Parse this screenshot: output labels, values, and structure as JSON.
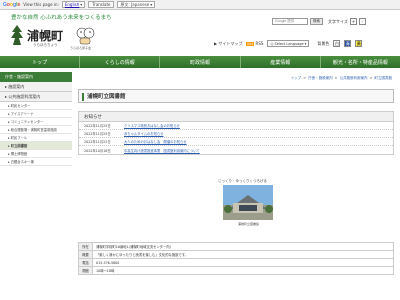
{
  "translate": {
    "brand_letters": [
      "G",
      "o",
      "o",
      "g",
      "l",
      "e"
    ],
    "view_text": "View this page in:",
    "language": "English",
    "translate_button": "Translate",
    "original_option": "原文: Japanese"
  },
  "header": {
    "tagline": "豊かな自然 心ふれあう未来をつくるまち",
    "town_name": "浦幌町",
    "town_kana": "うらほろちょう",
    "mascot_name": "うらほろ男子会",
    "search_placeholder": "Google 提供",
    "search_button": "検索",
    "text_size_label": "文字サイズ",
    "size_up": "+",
    "size_down": "-",
    "sitemap": "サイトマップ",
    "rss": "RSS",
    "rss_label": "RSS",
    "lang_select": "Select Language",
    "bg_color_label": "背景色",
    "bg_white": "白",
    "bg_blue": "青",
    "bg_yellow": "黄"
  },
  "nav": [
    "トップ",
    "くらしの情報",
    "町政情報",
    "産業情報",
    "観光・名所・特産品情報"
  ],
  "breadcrumb": [
    "トップ",
    "庁舎・施設案内",
    "公共施設利用案内",
    "町立図書館"
  ],
  "sidebar": {
    "head": "庁舎・施設案内",
    "items": [
      {
        "label": "施設案内",
        "type": "main"
      },
      {
        "label": "公共施設利用案内",
        "type": "main"
      },
      {
        "label": "町民センター",
        "type": "sub"
      },
      {
        "label": "アイスアリーナ",
        "type": "sub"
      },
      {
        "label": "コミュニティセンター",
        "type": "sub"
      },
      {
        "label": "総合運動場・浦幌町営温泉施設",
        "type": "sub"
      },
      {
        "label": "町民プール",
        "type": "sub"
      },
      {
        "label": "町立図書館",
        "type": "sub",
        "active": true
      },
      {
        "label": "郷土博物館",
        "type": "sub"
      },
      {
        "label": "白銀台スキー場",
        "type": "sub"
      }
    ]
  },
  "page_title": "浦幌町立図書館",
  "news": {
    "title": "お知らせ",
    "rows": [
      {
        "date": "2022年11月25日",
        "title": "クリスマス特別おはなし会のお知らせ"
      },
      {
        "date": "2022年11月25日",
        "title": "赤ちゃんタイムのお知らせ"
      },
      {
        "date": "2022年11月22日",
        "title": "大人のためのおはなし会　開催のお知らせ"
      },
      {
        "date": "2022年10月18日",
        "title": "中高生向け読書推進事業　図書館利用案内について"
      }
    ]
  },
  "photo": {
    "caption": "じっくり・ゆっくりくつろげる",
    "label": "浦幌町立図書館"
  },
  "info": [
    {
      "key": "所在",
      "value": "浦幌町字桜町16番地1(浦幌町地域交流センター内)"
    },
    {
      "key": "概要",
      "value": "「楽しく静かにゆったりと読書を楽しむ」文化的な施設です。"
    },
    {
      "key": "電話",
      "value": "015-576-5800"
    },
    {
      "key": "開館",
      "value": "10時～18時"
    }
  ],
  "colors": {
    "nav_green": "#3d7d3a",
    "tagline_green": "#2a8a3a",
    "link_blue": "#2a5db0"
  }
}
